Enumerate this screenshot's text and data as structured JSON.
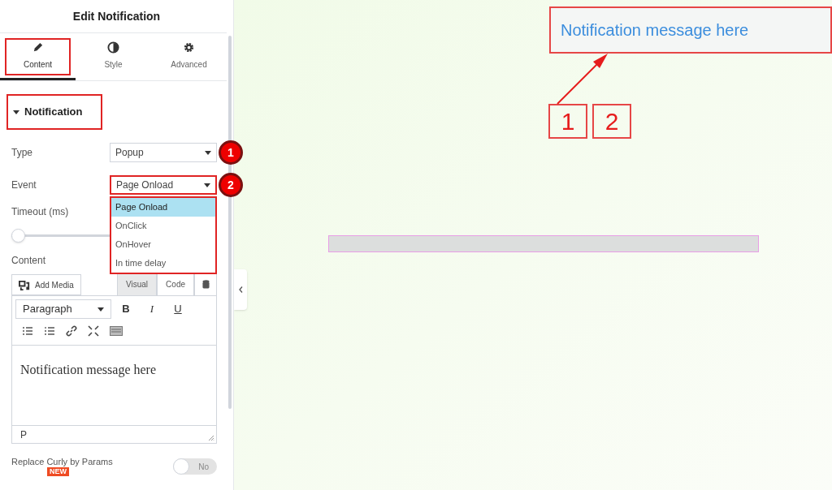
{
  "panel": {
    "title": "Edit Notification",
    "tabs": [
      {
        "label": "Content",
        "selected": true,
        "highlighted": true
      },
      {
        "label": "Style",
        "selected": false,
        "highlighted": false
      },
      {
        "label": "Advanced",
        "selected": false,
        "highlighted": false
      }
    ],
    "section": {
      "title": "Notification",
      "expanded": true,
      "highlighted": true
    },
    "type_field": {
      "label": "Type",
      "value": "Popup",
      "badge": "1",
      "highlighted": false
    },
    "event_field": {
      "label": "Event",
      "value": "Page Onload",
      "badge": "2",
      "highlighted": true,
      "expanded": true,
      "options": [
        {
          "label": "Page Onload",
          "selected": true
        },
        {
          "label": "OnClick",
          "selected": false
        },
        {
          "label": "OnHover",
          "selected": false
        },
        {
          "label": "In time delay",
          "selected": false
        }
      ]
    },
    "timeout": {
      "label": "Timeout (ms)",
      "level": 0
    },
    "content": {
      "label": "Content",
      "add_media": "Add Media",
      "editor_tabs": [
        {
          "label": "Visual",
          "selected": true
        },
        {
          "label": "Code",
          "selected": false
        }
      ],
      "format": "Paragraph",
      "bold": "B",
      "italic": "I",
      "underline": "U",
      "body": "Notification message here",
      "path": "P"
    },
    "toggle": {
      "label": "Replace Curly by Params",
      "badge": "NEW",
      "on": false,
      "state_text": "No"
    }
  },
  "canvas": {
    "notification": "Notification message here",
    "markers": [
      "1",
      "2"
    ]
  }
}
